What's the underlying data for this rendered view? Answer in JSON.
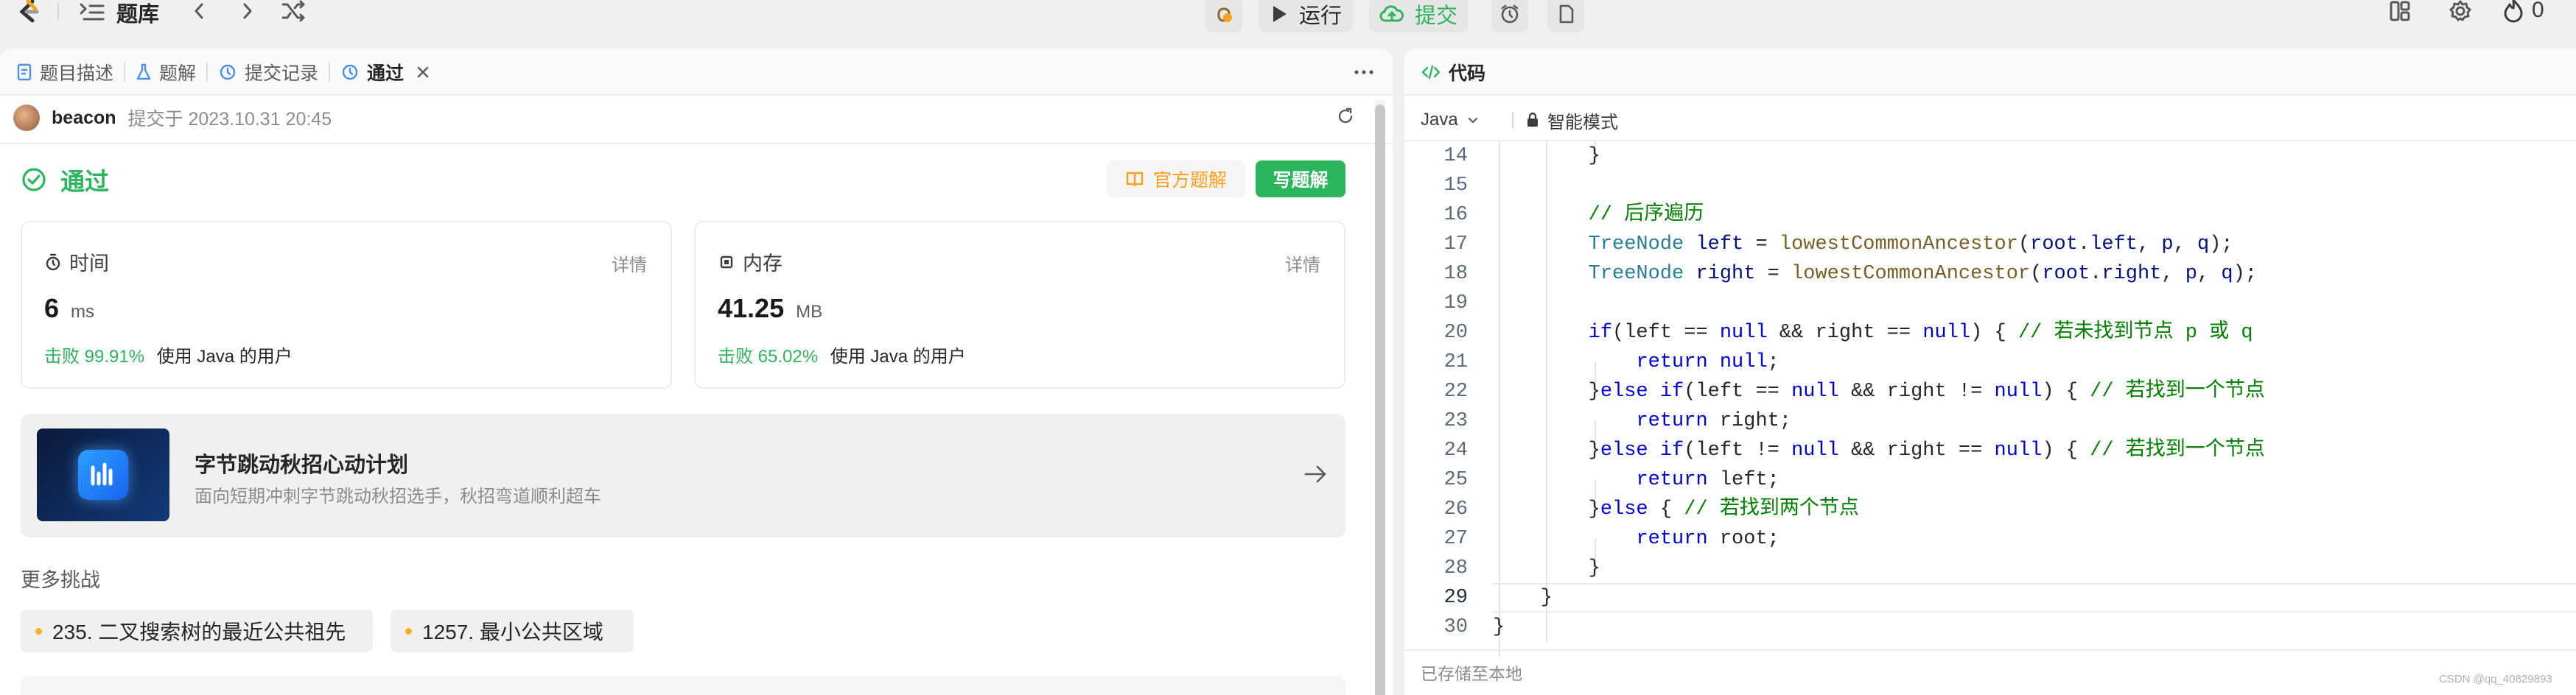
{
  "topbar": {
    "problem_list": "题库",
    "run": "运行",
    "submit": "提交",
    "streak": "0"
  },
  "left_tabs": [
    {
      "label": "题目描述"
    },
    {
      "label": "题解"
    },
    {
      "label": "提交记录"
    },
    {
      "label": "通过"
    }
  ],
  "submission": {
    "user": "beacon",
    "submitted_at": "提交于 2023.10.31 20:45",
    "status": "通过",
    "official_solution": "官方题解",
    "write_solution": "写题解"
  },
  "time_card": {
    "title": "时间",
    "detail": "详情",
    "value": "6",
    "unit": "ms",
    "beats": "击败 99.91%",
    "suffix": "使用 Java 的用户"
  },
  "memory_card": {
    "title": "内存",
    "detail": "详情",
    "value": "41.25",
    "unit": "MB",
    "beats": "击败 65.02%",
    "suffix": "使用 Java 的用户"
  },
  "banner": {
    "title": "字节跳动秋招心动计划",
    "subtitle": "面向短期冲刺字节跳动秋招选手，秋招弯道顺利超车"
  },
  "more": {
    "heading": "更多挑战",
    "items": [
      {
        "label": "235. 二叉搜索树的最近公共祖先"
      },
      {
        "label": "1257. 最小公共区域"
      }
    ]
  },
  "code_panel": {
    "title": "代码",
    "language": "Java",
    "mode": "智能模式",
    "saved": "已存储至本地",
    "watermark": "CSDN @qq_40829893",
    "line_numbers": [
      "14",
      "15",
      "16",
      "17",
      "18",
      "19",
      "20",
      "21",
      "22",
      "23",
      "24",
      "25",
      "26",
      "27",
      "28",
      "29",
      "30"
    ]
  },
  "colors": {
    "accent_green": "#2db55d",
    "official_orange": "#ff9f1a",
    "keyword_blue": "#0000d6",
    "type_teal": "#267f99",
    "function_brown": "#795e26",
    "comment_green": "#008000"
  }
}
